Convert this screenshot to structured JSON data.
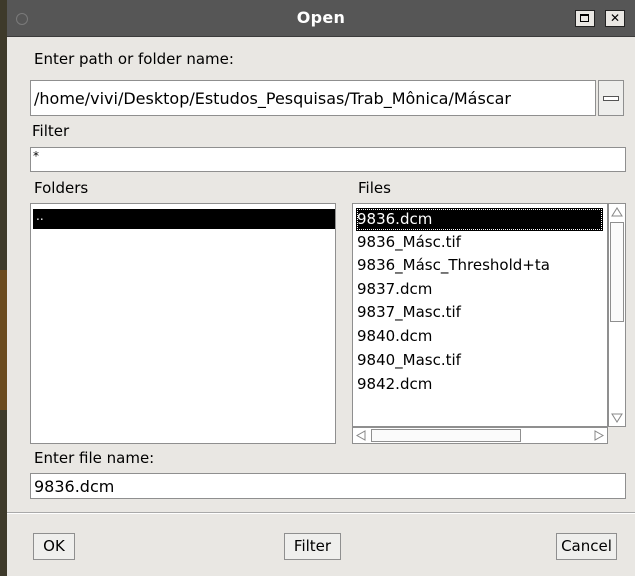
{
  "window": {
    "title": "Open"
  },
  "path": {
    "label": "Enter path or folder name:",
    "value": "/home/vivi/Desktop/Estudos_Pesquisas/Trab_Mônica/Máscar"
  },
  "filter": {
    "label": "Filter",
    "value": "*"
  },
  "folders": {
    "label": "Folders",
    "items": [
      ".."
    ]
  },
  "files": {
    "label": "Files",
    "items": [
      "9836.dcm",
      "9836_Másc.tif",
      "9836_Másc_Threshold+ta",
      "9837.dcm",
      "9837_Masc.tif",
      "9840.dcm",
      "9840_Masc.tif",
      "9842.dcm"
    ],
    "selected_index": 0
  },
  "filename": {
    "label": "Enter file name:",
    "value": "9836.dcm"
  },
  "buttons": {
    "ok": "OK",
    "filter": "Filter",
    "cancel": "Cancel"
  },
  "icons": {
    "close": "close-icon",
    "maximize": "maximize-icon",
    "window_menu": "window-menu-icon"
  }
}
